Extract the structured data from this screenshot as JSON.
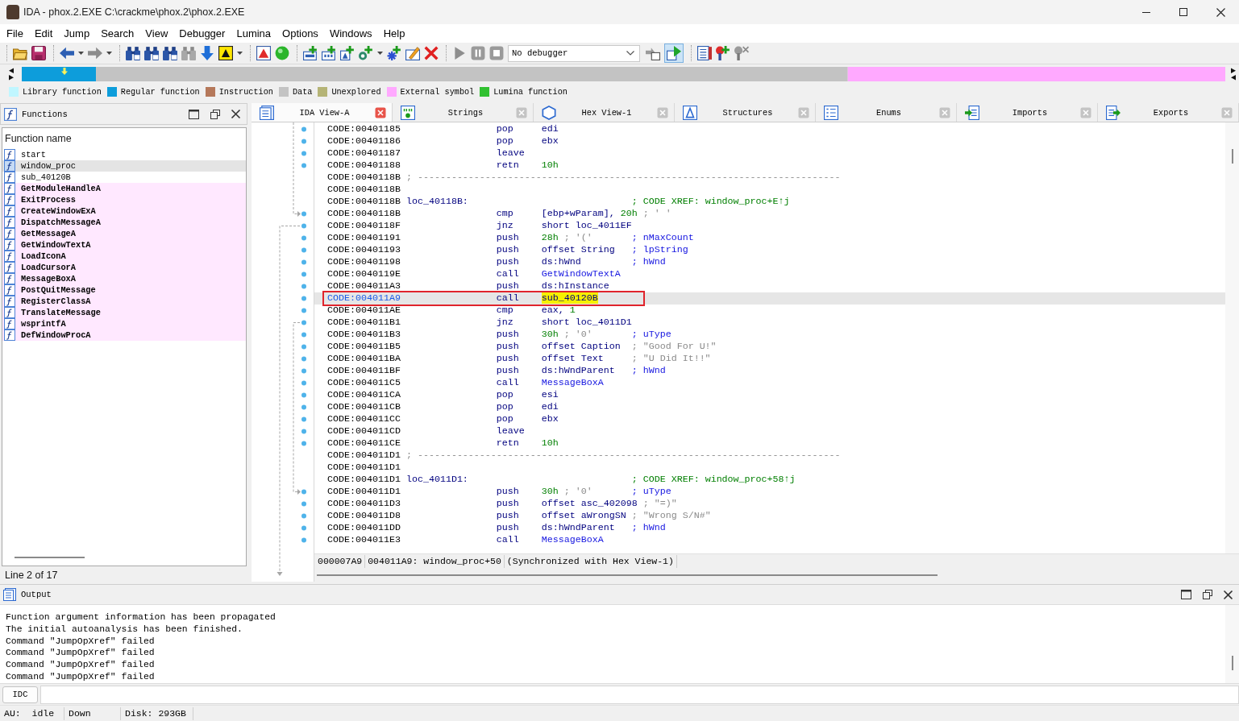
{
  "window": {
    "title": "IDA - phox.2.EXE C:\\crackme\\phox.2\\phox.2.EXE"
  },
  "menu": [
    "File",
    "Edit",
    "Jump",
    "Search",
    "View",
    "Debugger",
    "Lumina",
    "Options",
    "Windows",
    "Help"
  ],
  "toolbar": {
    "debugger_select": {
      "value": "No debugger"
    },
    "toggle_button": {
      "pressed": true
    }
  },
  "legend": [
    {
      "label": "Library function",
      "color": "#c0f6ff"
    },
    {
      "label": "Regular function",
      "color": "#0d9ddb"
    },
    {
      "label": "Instruction",
      "color": "#b5785a"
    },
    {
      "label": "Data",
      "color": "#c3c3c3"
    },
    {
      "label": "Unexplored",
      "color": "#b5b476"
    },
    {
      "label": "External symbol",
      "color": "#ffa9ff"
    },
    {
      "label": "Lumina function",
      "color": "#31c131"
    }
  ],
  "functions_panel": {
    "title": "Functions",
    "column": "Function name",
    "rows": [
      {
        "name": "start",
        "kind": "local",
        "selected": false
      },
      {
        "name": "window_proc",
        "kind": "local",
        "selected": true
      },
      {
        "name": "sub_40120B",
        "kind": "local",
        "selected": false
      },
      {
        "name": "GetModuleHandleA",
        "kind": "import",
        "selected": false
      },
      {
        "name": "ExitProcess",
        "kind": "import",
        "selected": false
      },
      {
        "name": "CreateWindowExA",
        "kind": "import",
        "selected": false
      },
      {
        "name": "DispatchMessageA",
        "kind": "import",
        "selected": false
      },
      {
        "name": "GetMessageA",
        "kind": "import",
        "selected": false
      },
      {
        "name": "GetWindowTextA",
        "kind": "import",
        "selected": false
      },
      {
        "name": "LoadIconA",
        "kind": "import",
        "selected": false
      },
      {
        "name": "LoadCursorA",
        "kind": "import",
        "selected": false
      },
      {
        "name": "MessageBoxA",
        "kind": "import",
        "selected": false
      },
      {
        "name": "PostQuitMessage",
        "kind": "import",
        "selected": false
      },
      {
        "name": "RegisterClassA",
        "kind": "import",
        "selected": false
      },
      {
        "name": "TranslateMessage",
        "kind": "import",
        "selected": false
      },
      {
        "name": "wsprintfA",
        "kind": "import",
        "selected": false
      },
      {
        "name": "DefWindowProcA",
        "kind": "import",
        "selected": false
      }
    ],
    "status": "Line 2 of 17"
  },
  "view_tabs": [
    {
      "label": "IDA View-A",
      "selected": true
    },
    {
      "label": "Strings",
      "selected": false
    },
    {
      "label": "Hex View-1",
      "selected": false
    },
    {
      "label": "Structures",
      "selected": false
    },
    {
      "label": "Enums",
      "selected": false
    },
    {
      "label": "Imports",
      "selected": false
    },
    {
      "label": "Exports",
      "selected": false
    }
  ],
  "disassembly": {
    "lines": [
      {
        "kind": "instruction",
        "address": "CODE:00401185",
        "mnemonic": "pop",
        "operands": [
          {
            "text": "edi",
            "kind": "text"
          }
        ],
        "selected": false,
        "boxed": false
      },
      {
        "kind": "instruction",
        "address": "CODE:00401186",
        "mnemonic": "pop",
        "operands": [
          {
            "text": "ebx",
            "kind": "text"
          }
        ],
        "selected": false,
        "boxed": false
      },
      {
        "kind": "instruction",
        "address": "CODE:00401187",
        "mnemonic": "leave",
        "selected": false,
        "boxed": false
      },
      {
        "kind": "instruction",
        "address": "CODE:00401188",
        "mnemonic": "retn",
        "operands": [
          {
            "text": "10h",
            "kind": "number"
          }
        ],
        "selected": false,
        "boxed": false
      },
      {
        "kind": "separator",
        "address": "CODE:0040118B",
        "text": "; ---------------------------------------------------------------------------",
        "selected": false,
        "boxed": false
      },
      {
        "kind": "blank",
        "address": "CODE:0040118B",
        "selected": false,
        "boxed": false
      },
      {
        "kind": "label",
        "address": "CODE:0040118B",
        "label": "loc_40118B:",
        "comment": {
          "text": "; CODE XREF: window_proc+E↑j",
          "kind": "xref"
        },
        "selected": false,
        "boxed": false
      },
      {
        "kind": "instruction",
        "address": "CODE:0040118B",
        "mnemonic": "cmp",
        "operands": [
          {
            "text": "[ebp+wParam], ",
            "kind": "text"
          },
          {
            "text": "20h",
            "kind": "number"
          },
          {
            "text": " ; ' '",
            "kind": "char"
          }
        ],
        "selected": false,
        "boxed": false
      },
      {
        "kind": "instruction",
        "address": "CODE:0040118F",
        "mnemonic": "jnz",
        "operands": [
          {
            "text": "short loc_4011EF",
            "kind": "text"
          }
        ],
        "selected": false,
        "boxed": false
      },
      {
        "kind": "instruction",
        "address": "CODE:00401191",
        "mnemonic": "push",
        "operands": [
          {
            "text": "28h",
            "kind": "number"
          },
          {
            "text": " ; '('",
            "kind": "char"
          }
        ],
        "comment": {
          "text": "; nMaxCount",
          "kind": "arg"
        },
        "selected": false,
        "boxed": false
      },
      {
        "kind": "instruction",
        "address": "CODE:00401193",
        "mnemonic": "push",
        "operands": [
          {
            "text": "offset String",
            "kind": "text"
          }
        ],
        "comment": {
          "text": "; lpString",
          "kind": "arg"
        },
        "selected": false,
        "boxed": false
      },
      {
        "kind": "instruction",
        "address": "CODE:00401198",
        "mnemonic": "push",
        "operands": [
          {
            "text": "ds:hWnd",
            "kind": "text"
          }
        ],
        "comment": {
          "text": "; hWnd",
          "kind": "arg"
        },
        "selected": false,
        "boxed": false
      },
      {
        "kind": "instruction",
        "address": "CODE:0040119E",
        "mnemonic": "call",
        "operands": [
          {
            "text": "GetWindowTextA",
            "kind": "import"
          }
        ],
        "selected": false,
        "boxed": false
      },
      {
        "kind": "instruction",
        "address": "CODE:004011A3",
        "mnemonic": "push",
        "operands": [
          {
            "text": "ds:hInstance",
            "kind": "text"
          }
        ],
        "selected": false,
        "boxed": false
      },
      {
        "kind": "instruction",
        "address": "CODE:004011A9",
        "mnemonic": "call",
        "operands": [
          {
            "text": "sub_40120B",
            "kind": "highlight"
          }
        ],
        "selected": true,
        "boxed": true
      },
      {
        "kind": "instruction",
        "address": "CODE:004011AE",
        "mnemonic": "cmp",
        "operands": [
          {
            "text": "eax, ",
            "kind": "text"
          },
          {
            "text": "1",
            "kind": "number"
          }
        ],
        "selected": false,
        "boxed": false
      },
      {
        "kind": "instruction",
        "address": "CODE:004011B1",
        "mnemonic": "jnz",
        "operands": [
          {
            "text": "short loc_4011D1",
            "kind": "text"
          }
        ],
        "selected": false,
        "boxed": false
      },
      {
        "kind": "instruction",
        "address": "CODE:004011B3",
        "mnemonic": "push",
        "operands": [
          {
            "text": "30h",
            "kind": "number"
          },
          {
            "text": " ; '0'",
            "kind": "char"
          }
        ],
        "comment": {
          "text": "; uType",
          "kind": "arg"
        },
        "selected": false,
        "boxed": false
      },
      {
        "kind": "instruction",
        "address": "CODE:004011B5",
        "mnemonic": "push",
        "operands": [
          {
            "text": "offset Caption",
            "kind": "text"
          }
        ],
        "comment": {
          "text": "; \"Good For U!\"",
          "kind": "string"
        },
        "selected": false,
        "boxed": false
      },
      {
        "kind": "instruction",
        "address": "CODE:004011BA",
        "mnemonic": "push",
        "operands": [
          {
            "text": "offset Text",
            "kind": "text"
          }
        ],
        "comment": {
          "text": "; \"U Did It!!\"",
          "kind": "string"
        },
        "selected": false,
        "boxed": false
      },
      {
        "kind": "instruction",
        "address": "CODE:004011BF",
        "mnemonic": "push",
        "operands": [
          {
            "text": "ds:hWndParent",
            "kind": "text"
          }
        ],
        "comment": {
          "text": "; hWnd",
          "kind": "arg"
        },
        "selected": false,
        "boxed": false
      },
      {
        "kind": "instruction",
        "address": "CODE:004011C5",
        "mnemonic": "call",
        "operands": [
          {
            "text": "MessageBoxA",
            "kind": "import"
          }
        ],
        "selected": false,
        "boxed": false
      },
      {
        "kind": "instruction",
        "address": "CODE:004011CA",
        "mnemonic": "pop",
        "operands": [
          {
            "text": "esi",
            "kind": "text"
          }
        ],
        "selected": false,
        "boxed": false
      },
      {
        "kind": "instruction",
        "address": "CODE:004011CB",
        "mnemonic": "pop",
        "operands": [
          {
            "text": "edi",
            "kind": "text"
          }
        ],
        "selected": false,
        "boxed": false
      },
      {
        "kind": "instruction",
        "address": "CODE:004011CC",
        "mnemonic": "pop",
        "operands": [
          {
            "text": "ebx",
            "kind": "text"
          }
        ],
        "selected": false,
        "boxed": false
      },
      {
        "kind": "instruction",
        "address": "CODE:004011CD",
        "mnemonic": "leave",
        "selected": false,
        "boxed": false
      },
      {
        "kind": "instruction",
        "address": "CODE:004011CE",
        "mnemonic": "retn",
        "operands": [
          {
            "text": "10h",
            "kind": "number"
          }
        ],
        "selected": false,
        "boxed": false
      },
      {
        "kind": "separator",
        "address": "CODE:004011D1",
        "text": "; ---------------------------------------------------------------------------",
        "selected": false,
        "boxed": false
      },
      {
        "kind": "blank",
        "address": "CODE:004011D1",
        "selected": false,
        "boxed": false
      },
      {
        "kind": "label",
        "address": "CODE:004011D1",
        "label": "loc_4011D1:",
        "comment": {
          "text": "; CODE XREF: window_proc+58↑j",
          "kind": "xref"
        },
        "selected": false,
        "boxed": false
      },
      {
        "kind": "instruction",
        "address": "CODE:004011D1",
        "mnemonic": "push",
        "operands": [
          {
            "text": "30h",
            "kind": "number"
          },
          {
            "text": " ; '0'",
            "kind": "char"
          }
        ],
        "comment": {
          "text": "; uType",
          "kind": "arg"
        },
        "selected": false,
        "boxed": false
      },
      {
        "kind": "instruction",
        "address": "CODE:004011D3",
        "mnemonic": "push",
        "operands": [
          {
            "text": "offset asc_402098",
            "kind": "text"
          }
        ],
        "comment": {
          "text": "; \"=)\"",
          "kind": "string"
        },
        "selected": false,
        "boxed": false
      },
      {
        "kind": "instruction",
        "address": "CODE:004011D8",
        "mnemonic": "push",
        "operands": [
          {
            "text": "offset aWrongSN",
            "kind": "text"
          }
        ],
        "comment": {
          "text": "; \"Wrong S/N#\"",
          "kind": "string"
        },
        "selected": false,
        "boxed": false
      },
      {
        "kind": "instruction",
        "address": "CODE:004011DD",
        "mnemonic": "push",
        "operands": [
          {
            "text": "ds:hWndParent",
            "kind": "text"
          }
        ],
        "comment": {
          "text": "; hWnd",
          "kind": "arg"
        },
        "selected": false,
        "boxed": false
      },
      {
        "kind": "instruction",
        "address": "CODE:004011E3",
        "mnemonic": "call",
        "operands": [
          {
            "text": "MessageBoxA",
            "kind": "import"
          }
        ],
        "selected": false,
        "boxed": false
      }
    ],
    "status": [
      "000007A9",
      "004011A9: window_proc+50",
      "(Synchronized with Hex View-1)"
    ]
  },
  "output": {
    "title": "Output",
    "lines": [
      "Function argument information has been propagated",
      "The initial autoanalysis has been finished.",
      "Command \"JumpOpXref\" failed",
      "Command \"JumpOpXref\" failed",
      "Command \"JumpOpXref\" failed",
      "Command \"JumpOpXref\" failed"
    ]
  },
  "command_bar": {
    "language": "IDC"
  },
  "status_bar": [
    "AU:  idle",
    "Down",
    "Disk: 293GB"
  ]
}
